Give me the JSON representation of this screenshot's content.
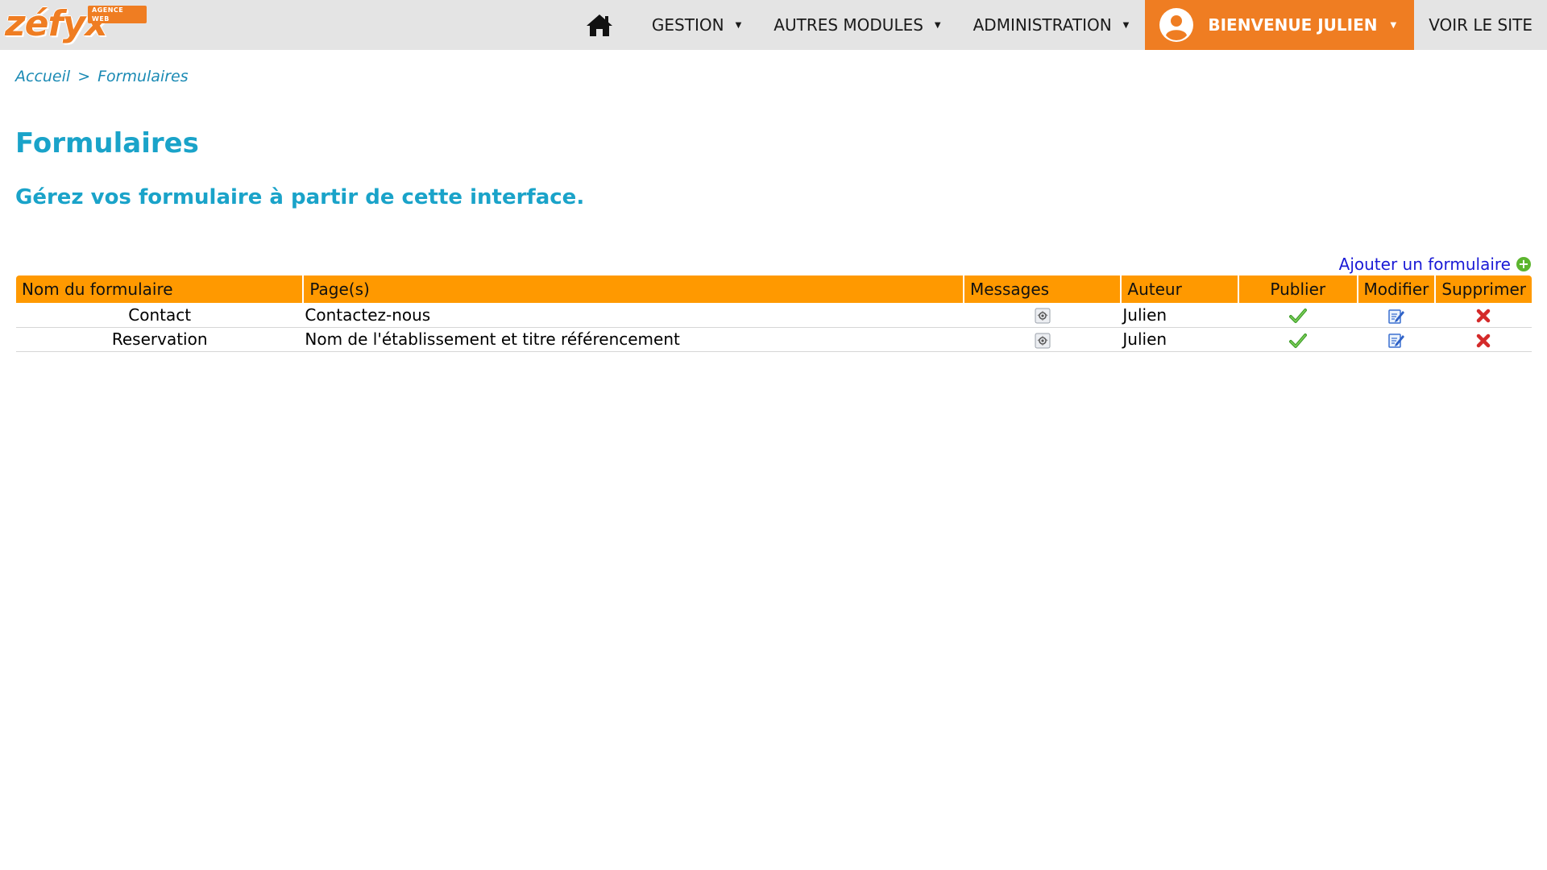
{
  "logo": {
    "text": "zéfyx",
    "tagline": "AGENCE WEB"
  },
  "nav": {
    "home_icon": "home-icon",
    "items": [
      {
        "label": "GESTION"
      },
      {
        "label": "AUTRES MODULES"
      },
      {
        "label": "ADMINISTRATION"
      }
    ],
    "user_label": "BIENVENUE JULIEN",
    "site_label": "VOIR LE SITE"
  },
  "breadcrumb": {
    "home": "Accueil",
    "separator": ">",
    "current": "Formulaires"
  },
  "page": {
    "title": "Formulaires",
    "subtitle": "Gérez vos formulaire à partir de cette interface."
  },
  "actions": {
    "add_label": "Ajouter un formulaire"
  },
  "table": {
    "columns": {
      "name": "Nom du formulaire",
      "pages": "Page(s)",
      "messages": "Messages",
      "author": "Auteur",
      "publish": "Publier",
      "edit": "Modifier",
      "delete": "Supprimer"
    },
    "rows": [
      {
        "name": "Contact",
        "pages": "Contactez-nous",
        "author": "Julien",
        "published": true
      },
      {
        "name": "Reservation",
        "pages": "Nom de l'établissement et titre référencement",
        "author": "Julien",
        "published": true
      }
    ]
  },
  "colors": {
    "topbar_bg": "#e4e4e4",
    "brand_orange": "#ef7d22",
    "table_header": "#ff9900",
    "title_blue": "#1aa3c9",
    "link_blue": "#1a1ad6",
    "breadcrumb_blue": "#1a8ab4"
  }
}
